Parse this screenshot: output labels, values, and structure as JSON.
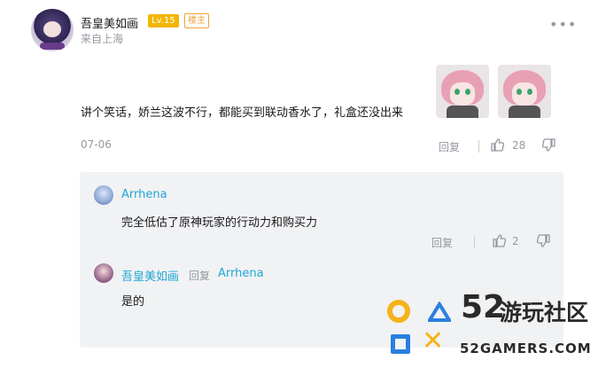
{
  "post": {
    "username": "吾皇美如画",
    "level_badge": "Lv.15",
    "owner_badge": "楼主",
    "location": "来自上海",
    "text": "讲个笑话，娇兰这波不行，都能买到联动香水了，礼盒还没出来",
    "date": "07-06",
    "reply_label": "回复",
    "like_count": "28",
    "stickers": [
      "sticker",
      "sticker"
    ]
  },
  "replies": [
    {
      "username": "Arrhena",
      "text": "完全低估了原神玩家的行动力和购买力",
      "reply_label": "回复",
      "like_count": "2"
    },
    {
      "username": "吾皇美如画",
      "reply_word": "回复",
      "reply_to": "Arrhena",
      "text": "是的"
    }
  ],
  "watermark": {
    "number": "52",
    "name": "游玩社区",
    "url": "52GAMERS.COM"
  },
  "colors": {
    "accent_blue": "#20a7d6",
    "level_gold": "#f2b600",
    "owner_orange": "#f2a23a",
    "muted_gray": "#9499a0"
  }
}
